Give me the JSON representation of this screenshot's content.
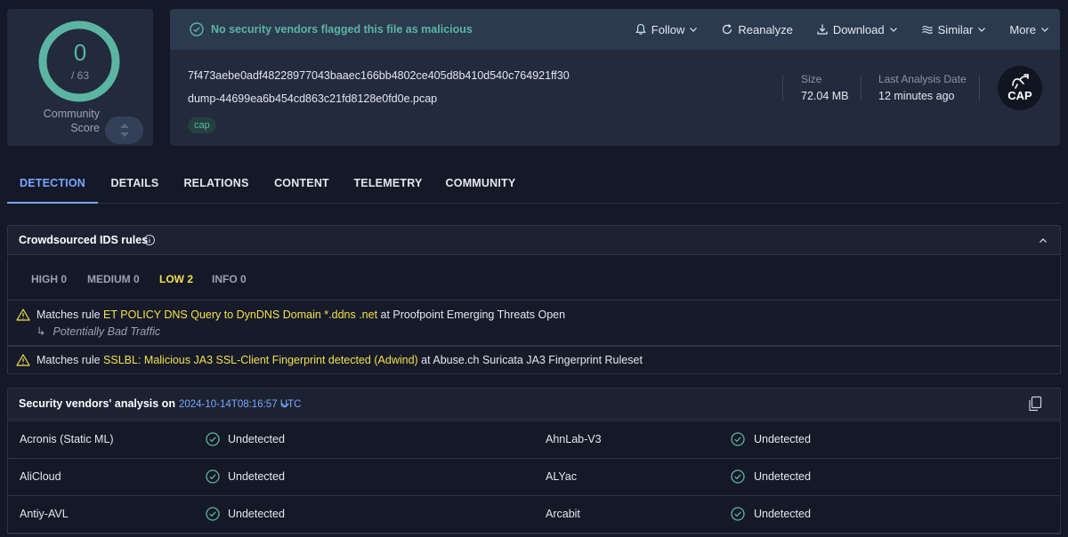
{
  "score": {
    "detections": "0",
    "total": "/ 63",
    "community_label_1": "Community",
    "community_label_2": "Score"
  },
  "header": {
    "status_text": "No security vendors flagged this file as malicious",
    "actions": [
      {
        "label": "Follow",
        "icon": "bell-icon",
        "dropdown": true
      },
      {
        "label": "Reanalyze",
        "icon": "refresh-icon",
        "dropdown": false
      },
      {
        "label": "Download",
        "icon": "download-icon",
        "dropdown": true
      },
      {
        "label": "Similar",
        "icon": "similar-icon",
        "dropdown": true
      },
      {
        "label": "More",
        "icon": "",
        "dropdown": true
      }
    ],
    "hash": "7f473aebe0adf48228977043baaec166bb4802ce405d8b410d540c764921ff30",
    "filename": "dump-44699ea6b454cd863c21fd8128e0fd0e.pcap",
    "tag": "cap",
    "size_label": "Size",
    "size_value": "72.04 MB",
    "date_label": "Last Analysis Date",
    "date_value": "12 minutes ago",
    "file_type_badge": "CAP"
  },
  "tabs": [
    "DETECTION",
    "DETAILS",
    "RELATIONS",
    "CONTENT",
    "TELEMETRY",
    "COMMUNITY"
  ],
  "active_tab": "DETECTION",
  "ids": {
    "title": "Crowdsourced IDS rules",
    "severities": [
      "HIGH 0",
      "MEDIUM 0",
      "LOW 2",
      "INFO 0"
    ],
    "active_severity": "LOW 2",
    "rules": [
      {
        "prefix": "Matches rule",
        "rule": "ET POLICY DNS Query to DynDNS Domain *.ddns .net",
        "suffix": "at Proofpoint Emerging Threats Open",
        "sub": "Potentially Bad Traffic"
      },
      {
        "prefix": "Matches rule",
        "rule": "SSLBL: Malicious JA3 SSL-Client Fingerprint detected (Adwind)",
        "suffix": "at Abuse.ch Suricata JA3 Fingerprint Ruleset",
        "sub": ""
      }
    ]
  },
  "vendors": {
    "title": "Security vendors' analysis on",
    "date": "2024-10-14T08:16:57 UTC",
    "rows": [
      {
        "left_name": "Acronis (Static ML)",
        "left_result": "Undetected",
        "right_name": "AhnLab-V3",
        "right_result": "Undetected"
      },
      {
        "left_name": "AliCloud",
        "left_result": "Undetected",
        "right_name": "ALYac",
        "right_result": "Undetected"
      },
      {
        "left_name": "Antiy-AVL",
        "left_result": "Undetected",
        "right_name": "Arcabit",
        "right_result": "Undetected"
      }
    ]
  },
  "colors": {
    "accent": "#7aa7ff",
    "success": "#5bb5a2",
    "warning": "#f2e14c",
    "background": "#151827",
    "card": "#222a3c"
  }
}
